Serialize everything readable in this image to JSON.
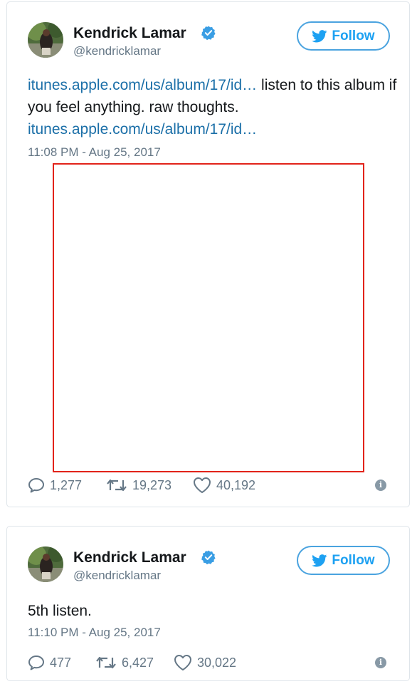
{
  "tweets": [
    {
      "display_name": "Kendrick Lamar",
      "handle": "@kendricklamar",
      "follow_label": "Follow",
      "text_parts": {
        "link_1": "itunes.apple.com/us/album/17/id…",
        "text_1": " listen to this album if you feel anything. raw thoughts. ",
        "link_2": "itunes.apple.com/us/album/17/id…"
      },
      "timestamp": "11:08 PM - Aug 25, 2017",
      "replies": "1,277",
      "retweets": "19,273",
      "likes": "40,192"
    },
    {
      "display_name": "Kendrick Lamar",
      "handle": "@kendricklamar",
      "follow_label": "Follow",
      "text": "5th listen.",
      "timestamp": "11:10 PM - Aug 25, 2017",
      "replies": "477",
      "retweets": "6,427",
      "likes": "30,022"
    }
  ],
  "icons": {
    "verified": "verified-badge-icon",
    "follow": "twitter-bird-icon",
    "reply": "reply-icon",
    "retweet": "retweet-icon",
    "like": "heart-icon",
    "info": "info-icon"
  },
  "colors": {
    "accent": "#1da1f2",
    "link": "#1b6fa8",
    "muted": "#657786",
    "highlight_border": "#e2231a"
  }
}
